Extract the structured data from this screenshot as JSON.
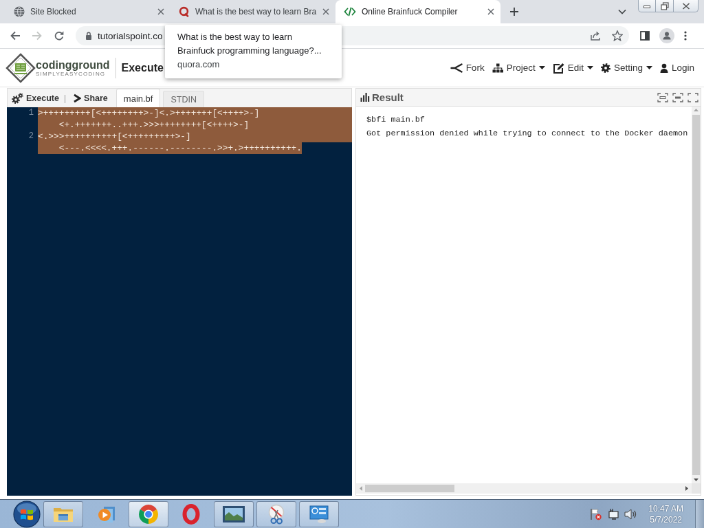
{
  "browser": {
    "tabs": [
      {
        "title": "Site Blocked",
        "selected": false
      },
      {
        "title": "What is the best way to learn Bra",
        "selected": false
      },
      {
        "title": "Online Brainfuck Compiler",
        "selected": true
      }
    ],
    "nav": [
      {
        "disabled": false
      },
      {
        "disabled": true
      },
      {
        "disabled": false
      }
    ],
    "address": {
      "url": "tutorialspoint.co"
    },
    "tooltip": {
      "title": "What is the best way to learn Brainfuck programming language?...",
      "domain": "quora.com"
    }
  },
  "header": {
    "logo": {
      "name": "codingground",
      "tagline": "SIMPLYEASYCODING"
    },
    "title": "Execute",
    "menu": [
      {
        "label": "Fork",
        "dropdown": false
      },
      {
        "label": "Project",
        "dropdown": true
      },
      {
        "label": "Edit",
        "dropdown": true
      },
      {
        "label": "Setting",
        "dropdown": true
      },
      {
        "label": "Login",
        "dropdown": false
      }
    ]
  },
  "editor_panel": {
    "toolbar": [
      {
        "kind": "button",
        "label": "Execute"
      },
      {
        "kind": "divider",
        "label": "|"
      },
      {
        "kind": "button",
        "label": "Share"
      }
    ],
    "tabs": [
      {
        "label": "main.bf",
        "selected": true
      },
      {
        "label": "STDIN",
        "selected": false
      }
    ],
    "selected": true,
    "lines": [
      {
        "number": "1",
        "rows": [
          ">+++++++++[<++++++++>-]<.>+++++++[<++++>-]",
          "<+.+++++++..+++.>>>++++++++[<++++>-]"
        ]
      },
      {
        "number": "2",
        "rows": [
          "<.>>>++++++++++[<+++++++++>-]",
          "<---.<<<<.+++.------.--------.>>+.>++++++++++."
        ]
      }
    ]
  },
  "result_panel": {
    "title": "Result",
    "output": [
      "$bfi main.bf",
      "Got permission denied while trying to connect to the Docker daemon"
    ]
  },
  "taskbar": {
    "apps": [
      {
        "running": true,
        "active": false
      },
      {
        "running": false,
        "active": false
      },
      {
        "running": true,
        "active": true
      },
      {
        "running": false,
        "active": false
      },
      {
        "running": true,
        "active": false
      },
      {
        "running": true,
        "active": false
      },
      {
        "running": true,
        "active": false
      }
    ],
    "clock": {
      "time": "10:47 AM",
      "date": "5/7/2022"
    }
  }
}
